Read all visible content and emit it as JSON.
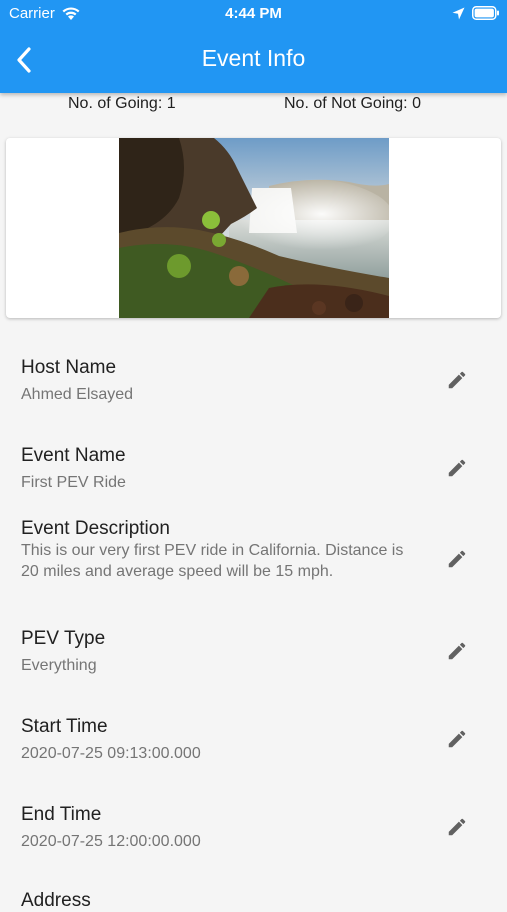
{
  "status_bar": {
    "carrier": "Carrier",
    "time": "4:44 PM"
  },
  "app_bar": {
    "title": "Event Info",
    "back_icon": "chevron-left-icon",
    "color": "#2196f3"
  },
  "attendance": {
    "going": "No. of Going: 1",
    "not_going": "No. of Not Going: 0"
  },
  "fields": [
    {
      "label": "Host Name",
      "value": "Ahmed Elsayed"
    },
    {
      "label": "Event Name",
      "value": "First PEV Ride"
    },
    {
      "label": "Event Description",
      "value": "This is our very first PEV ride in California. Distance is 20 miles and average speed will be 15 mph."
    },
    {
      "label": "PEV Type",
      "value": "Everything"
    },
    {
      "label": "Start Time",
      "value": "2020-07-25 09:13:00.000"
    },
    {
      "label": "End Time",
      "value": "2020-07-25 12:00:00.000"
    },
    {
      "label": "Address",
      "value": ""
    }
  ],
  "edit_icon": "pencil-icon"
}
